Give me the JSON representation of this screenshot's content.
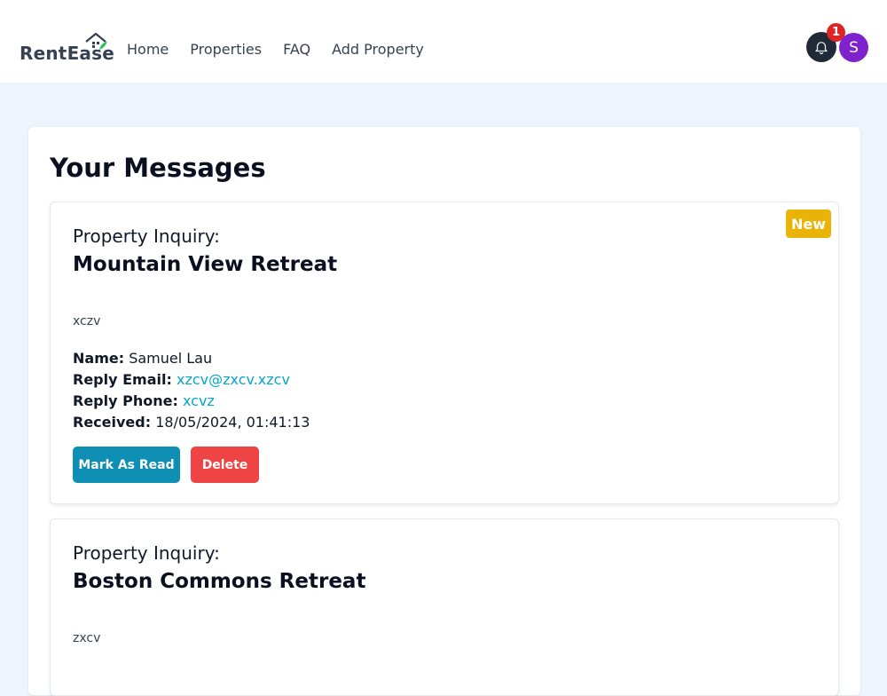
{
  "brand": {
    "name": "RentEase"
  },
  "nav": {
    "links": [
      {
        "label": "Home"
      },
      {
        "label": "Properties"
      },
      {
        "label": "FAQ"
      },
      {
        "label": "Add Property"
      }
    ]
  },
  "header": {
    "notification_count": "1",
    "avatar_initial": "S"
  },
  "page": {
    "title": "Your Messages"
  },
  "messages": [
    {
      "badge": "New",
      "subject_label": "Property Inquiry:",
      "property": "Mountain View Retreat",
      "body": "xczv",
      "name_label": "Name:",
      "name": "Samuel Lau",
      "email_label": "Reply Email:",
      "email": "xzcv@zxcv.xzcv",
      "phone_label": "Reply Phone:",
      "phone": "xcvz",
      "received_label": "Received:",
      "received": "18/05/2024, 01:41:13",
      "mark_read_label": "Mark As Read",
      "delete_label": "Delete"
    },
    {
      "subject_label": "Property Inquiry:",
      "property": "Boston Commons Retreat",
      "body": "zxcv"
    }
  ],
  "colors": {
    "background": "#eef4fd",
    "accent": "#0e8fb3",
    "danger": "#ef4444",
    "badge": "#eab308",
    "link": "#06a6c9",
    "avatar": "#7e22ce"
  }
}
